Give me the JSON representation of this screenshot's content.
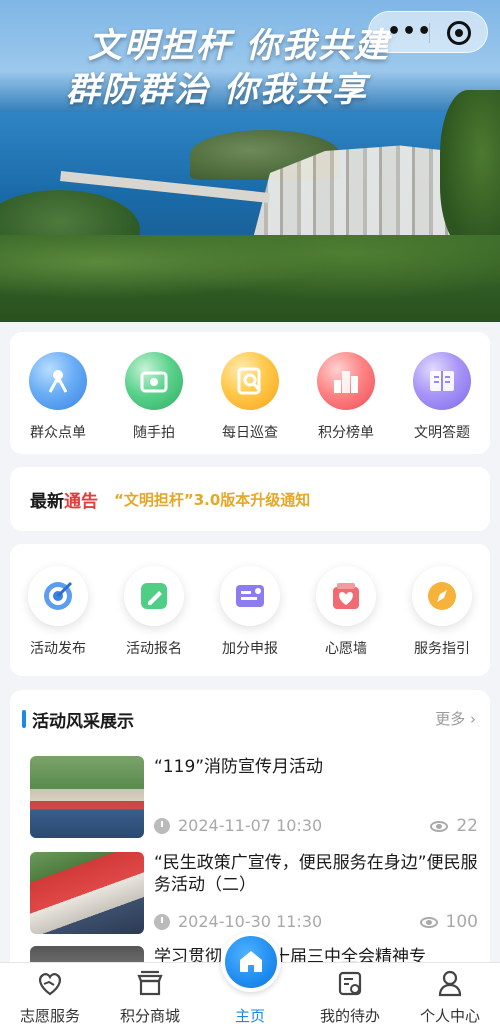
{
  "banner": {
    "slogan_line1": "文明担杆  你我共建",
    "slogan_line2": "群防群治  你我共享"
  },
  "capsule": {
    "more_icon": "more-dots-icon",
    "close_icon": "target-close-icon"
  },
  "quick_menu": [
    {
      "label": "群众点单",
      "icon": "order-icon",
      "color": "#3a82e6"
    },
    {
      "label": "随手拍",
      "icon": "camera-icon",
      "color": "#2fae63"
    },
    {
      "label": "每日巡查",
      "icon": "inspect-icon",
      "color": "#f7a21c"
    },
    {
      "label": "积分榜单",
      "icon": "ranking-icon",
      "color": "#ec4b55"
    },
    {
      "label": "文明答题",
      "icon": "quiz-icon",
      "color": "#7e6be8"
    }
  ],
  "notice": {
    "prefix": "最新",
    "highlight": "通告",
    "text": "“文明担杆”3.0版本升级通知"
  },
  "service_menu": [
    {
      "label": "活动发布",
      "icon": "target-icon",
      "color": "#3a82e6"
    },
    {
      "label": "活动报名",
      "icon": "edit-icon",
      "color": "#2fae63"
    },
    {
      "label": "加分申报",
      "icon": "card-icon",
      "color": "#7e6be8"
    },
    {
      "label": "心愿墙",
      "icon": "heart-icon",
      "color": "#ec4b55"
    },
    {
      "label": "服务指引",
      "icon": "compass-icon",
      "color": "#f7a21c"
    }
  ],
  "activities": {
    "title": "活动风采展示",
    "more": "更多",
    "items": [
      {
        "title": "“119”消防宣传月活动",
        "date": "2024-11-07 10:30",
        "views": "22"
      },
      {
        "title": "“民生政策广宣传，便民服务在身边”便民服务活动（二）",
        "date": "2024-10-30 11:30",
        "views": "100"
      },
      {
        "title": "学习贯彻党的二十届三中全会精神专",
        "date": "",
        "views": ""
      }
    ]
  },
  "tabbar": [
    {
      "label": "志愿服务",
      "icon": "volunteer-heart-icon"
    },
    {
      "label": "积分商城",
      "icon": "shop-icon"
    },
    {
      "label": "主页",
      "icon": "home-icon",
      "active": true
    },
    {
      "label": "我的待办",
      "icon": "todo-calendar-icon"
    },
    {
      "label": "个人中心",
      "icon": "user-icon"
    }
  ]
}
